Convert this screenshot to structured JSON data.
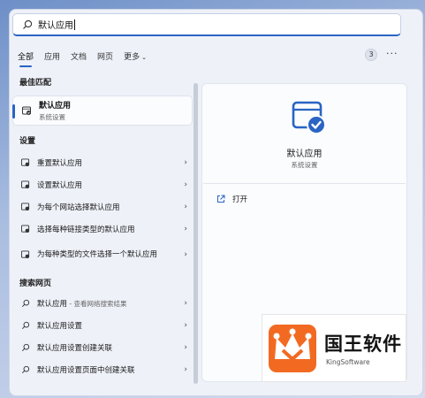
{
  "search": {
    "query": "默认应用"
  },
  "tabs": [
    {
      "label": "全部",
      "active": true
    },
    {
      "label": "应用"
    },
    {
      "label": "文档"
    },
    {
      "label": "网页"
    },
    {
      "label": "更多"
    }
  ],
  "badge_count": "3",
  "more_label": "···",
  "best_match": {
    "section": "最佳匹配",
    "title": "默认应用",
    "subtitle": "系统设置"
  },
  "settings": {
    "section": "设置",
    "items": [
      {
        "label": "重置默认应用"
      },
      {
        "label": "设置默认应用"
      },
      {
        "label": "为每个网站选择默认应用"
      },
      {
        "label": "选择每种链接类型的默认应用"
      },
      {
        "label": "为每种类型的文件选择一个默认应用"
      }
    ]
  },
  "web": {
    "section": "搜索网页",
    "items": [
      {
        "label": "默认应用",
        "suffix": " - 查看网络搜索结果"
      },
      {
        "label": "默认应用设置"
      },
      {
        "label": "默认应用设置创建关联"
      },
      {
        "label": "默认应用设置页面中创建关联"
      }
    ]
  },
  "detail": {
    "title": "默认应用",
    "subtitle": "系统设置",
    "open_label": "打开"
  },
  "watermark": {
    "cn": "国王软件",
    "en": "KingSoftware"
  },
  "colors": {
    "accent": "#2a64c4",
    "logo_orange": "#f26a21"
  }
}
